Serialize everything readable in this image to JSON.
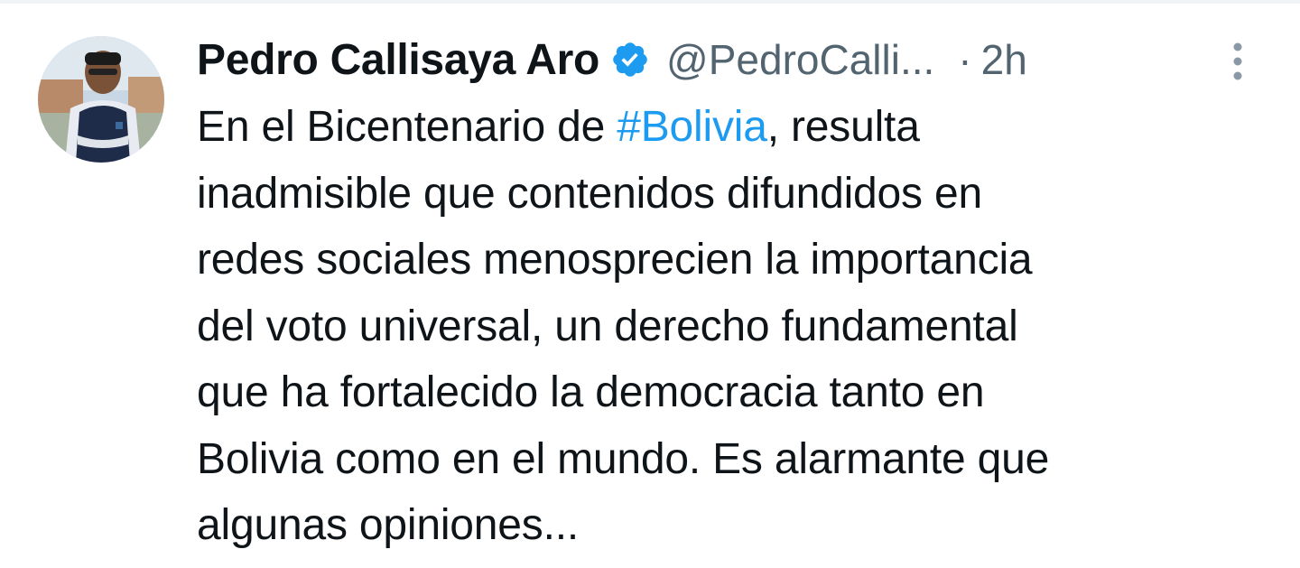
{
  "author": {
    "name": "Pedro Callisaya Aro",
    "handle": "@PedroCalli...",
    "separator": "·",
    "time": "2h"
  },
  "icons": {
    "verified": "verified-badge-icon",
    "more": "more-vertical-icon"
  },
  "colors": {
    "text": "#0f1419",
    "secondary": "#536471",
    "link": "#1d9bf0",
    "verified": "#1d9bf0"
  },
  "tweet": {
    "line1_before": "En el Bicentenario de ",
    "line1_hashtag": "#Bolivia",
    "line1_after": ", resulta",
    "line2": "inadmisible que contenidos difundidos en",
    "line3": "redes sociales menosprecien la importancia",
    "line4": "del voto universal, un derecho fundamental",
    "line5": "que ha fortalecido la democracia tanto en",
    "line6": "Bolivia como en el mundo. Es alarmante que",
    "line7": "algunas opiniones..."
  }
}
